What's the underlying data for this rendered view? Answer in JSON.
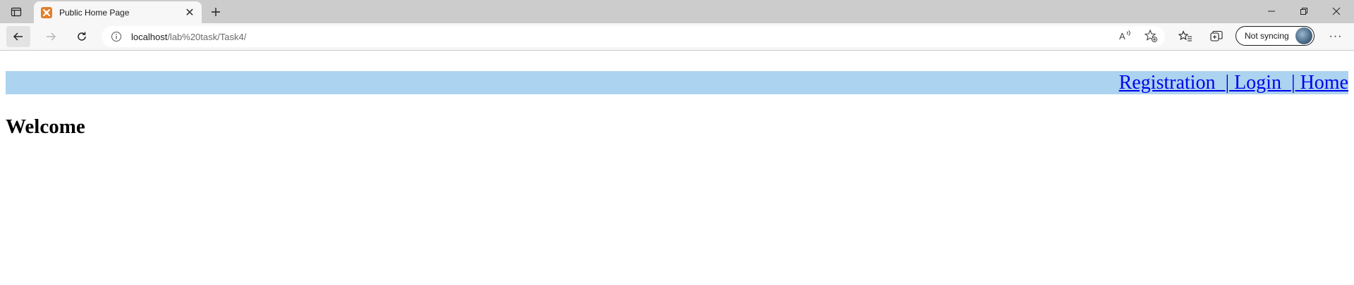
{
  "browser": {
    "tab": {
      "title": "Public Home Page"
    },
    "address": {
      "host": "localhost",
      "path": "/lab%20task/Task4/"
    },
    "profile": {
      "sync_label": "Not syncing"
    }
  },
  "page": {
    "nav": {
      "registration": "Registration",
      "login": "Login",
      "home": "Home",
      "separator": "|"
    },
    "heading": "Welcome"
  },
  "colors": {
    "nav_background": "#acd3ef",
    "link": "#0000ee",
    "favicon": "#e27f2b"
  }
}
